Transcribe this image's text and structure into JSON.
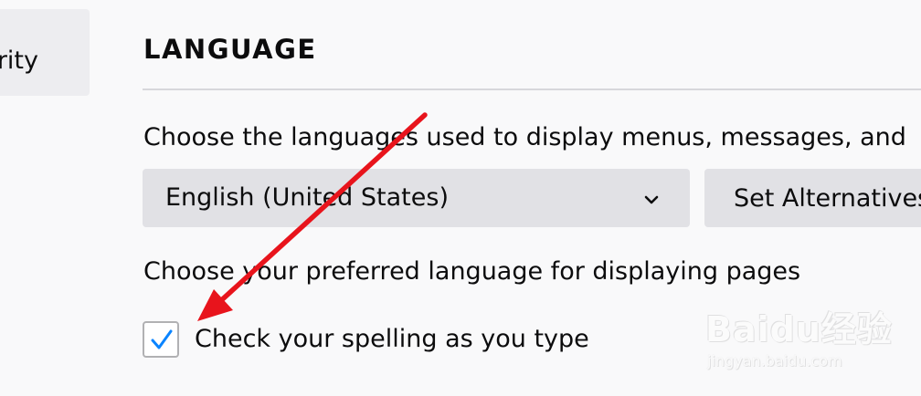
{
  "sidebar": {
    "active_item_label_fragment": "rity"
  },
  "language_section": {
    "title": "LANGUAGE",
    "description": "Choose the languages used to display menus, messages, and",
    "language_select": {
      "selected_value": "English (United States)",
      "icon": "chevron-down-icon"
    },
    "set_alternatives_label": "Set Alternatives",
    "preferred_language_label": "Choose your preferred language for displaying pages",
    "spellcheck": {
      "label": "Check your spelling as you type",
      "checked": true
    }
  },
  "annotation": {
    "arrow_color": "#e8141c"
  },
  "watermark": {
    "brand": "Bai",
    "brand_suffix": "du",
    "product": "经验",
    "url": "jingyan.baidu.com"
  },
  "colors": {
    "background": "#f9f9fa",
    "control_background": "#e1e1e5",
    "checkmark": "#0a84ff",
    "divider": "#d7d7db"
  }
}
